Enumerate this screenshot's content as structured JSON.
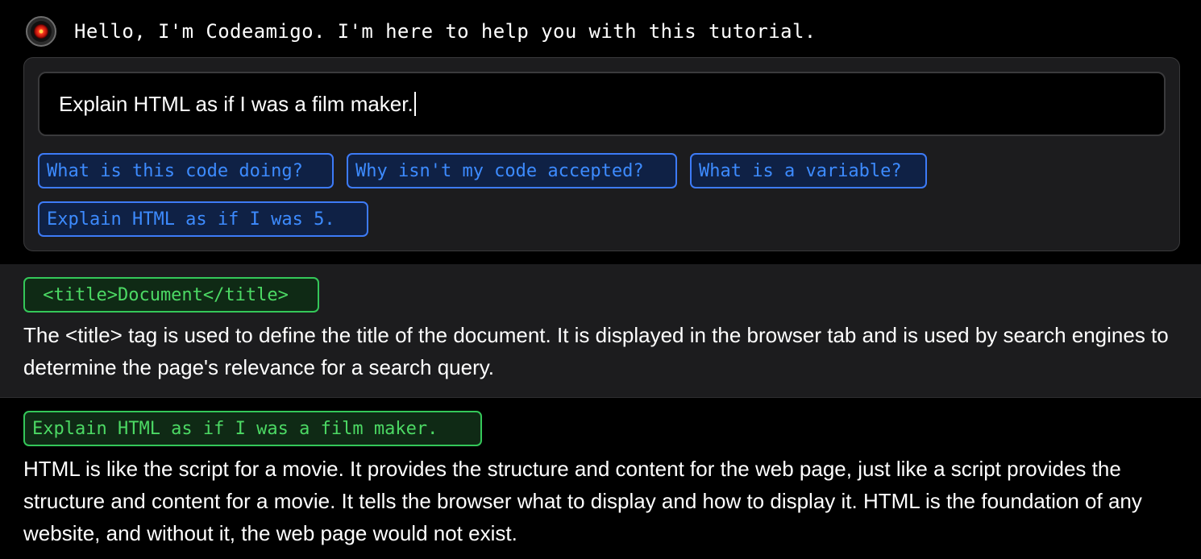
{
  "greeting": {
    "text": "Hello, I'm Codeamigo. I'm here to help you with this tutorial."
  },
  "ask": {
    "input_value": "Explain HTML as if I was a film maker.",
    "suggestions": [
      "What is this code doing?",
      "Why isn't my code accepted?",
      "What is a variable?",
      "Explain HTML as if I was 5."
    ]
  },
  "messages": [
    {
      "code": " <title>Document</title>",
      "text": "The <title> tag is used to define the title of the document. It is displayed in the browser tab and is used by search engines to determine the page's relevance for a search query."
    },
    {
      "code": "Explain HTML as if I was a film maker.",
      "text": "HTML is like the script for a movie. It provides the structure and content for the web page, just like a script provides the structure and content for a movie. It tells the browser what to display and how to display it. HTML is the foundation of any website, and without it, the web page would not exist."
    }
  ],
  "colors": {
    "background": "#000000",
    "panel": "#1c1c1e",
    "chip_border": "#3d7bf7",
    "chip_text": "#3d8bff",
    "code_border": "#34c759",
    "code_text": "#4cd964"
  },
  "icons": {
    "avatar": "red-eye-avatar-icon"
  }
}
